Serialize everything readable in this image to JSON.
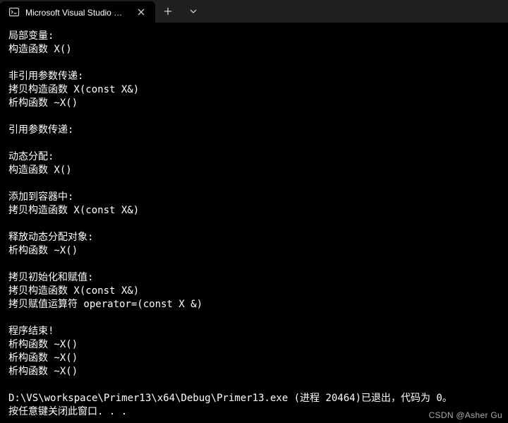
{
  "titlebar": {
    "tab_title": "Microsoft Visual Studio 调试控",
    "close": "×",
    "new_tab": "+",
    "dropdown": "⌄"
  },
  "terminal": {
    "lines": [
      "局部变量:",
      "构造函数 X()",
      "",
      "非引用参数传递:",
      "拷贝构造函数 X(const X&)",
      "析构函数 ~X()",
      "",
      "引用参数传递:",
      "",
      "动态分配:",
      "构造函数 X()",
      "",
      "添加到容器中:",
      "拷贝构造函数 X(const X&)",
      "",
      "释放动态分配对象:",
      "析构函数 ~X()",
      "",
      "拷贝初始化和赋值:",
      "拷贝构造函数 X(const X&)",
      "拷贝赋值运算符 operator=(const X &)",
      "",
      "程序结束!",
      "析构函数 ~X()",
      "析构函数 ~X()",
      "析构函数 ~X()",
      "",
      "D:\\VS\\workspace\\Primer13\\x64\\Debug\\Primer13.exe (进程 20464)已退出，代码为 0。",
      "按任意键关闭此窗口. . ."
    ]
  },
  "watermark": "CSDN @Asher Gu"
}
